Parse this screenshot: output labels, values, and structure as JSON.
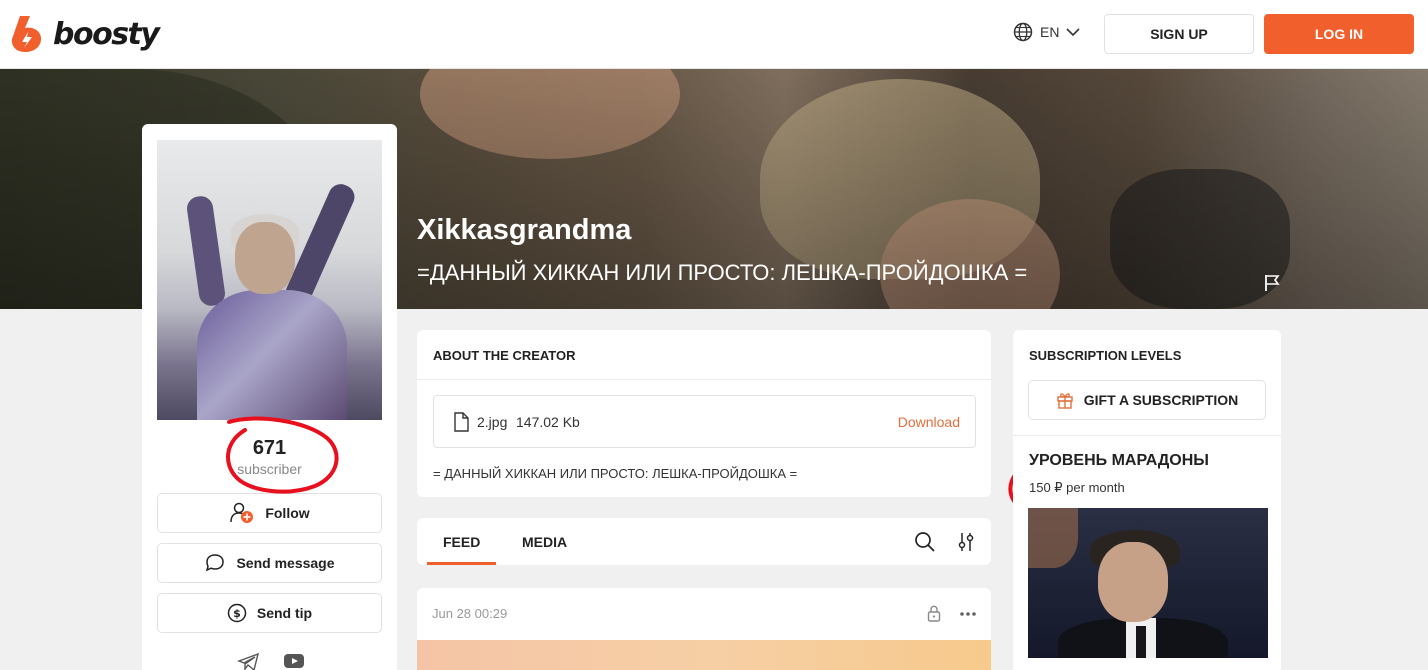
{
  "header": {
    "logo_text": "boosty",
    "lang": "EN",
    "signup_label": "SIGN UP",
    "login_label": "LOG IN",
    "accent_color": "#f15f2c"
  },
  "cover": {
    "title": "Xikkasgrandma",
    "subtitle": "=ДАННЫЙ ХИККАН ИЛИ ПРОСТО: ЛЕШКА-ПРОЙДОШКА ="
  },
  "profile": {
    "subscriber_count": "671",
    "subscriber_label": "subscriber",
    "follow_label": "Follow",
    "message_label": "Send message",
    "tip_label": "Send tip"
  },
  "about": {
    "title": "ABOUT THE CREATOR",
    "file_name": "2.jpg",
    "file_size": "147.02 Kb",
    "download_label": "Download",
    "description": "= ДАННЫЙ ХИККАН ИЛИ ПРОСТО: ЛЕШКА-ПРОЙДОШКА ="
  },
  "tabs": {
    "feed": "FEED",
    "media": "MEDIA",
    "active": "FEED"
  },
  "post": {
    "date": "Jun 28 00:29"
  },
  "subscriptions": {
    "title": "SUBSCRIPTION LEVELS",
    "gift_label": "GIFT A SUBSCRIPTION",
    "tier_name": "УРОВЕНЬ МАРАДОНЫ",
    "tier_price": "150 ₽ per month"
  },
  "icons": [
    "boosty-logo-icon",
    "globe-icon",
    "chevron-down-icon",
    "flag-icon",
    "follow-icon",
    "message-icon",
    "tip-icon",
    "file-icon",
    "search-icon",
    "filter-icon",
    "lock-icon",
    "more-icon",
    "gift-icon",
    "telegram-icon",
    "youtube-icon"
  ]
}
